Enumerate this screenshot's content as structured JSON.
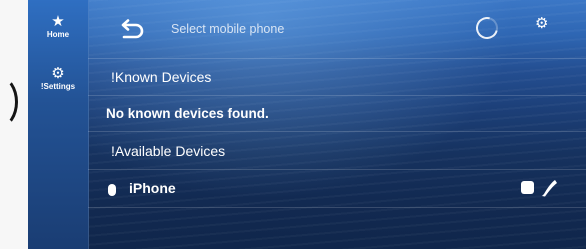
{
  "sidebar": {
    "items": [
      {
        "label": "Home",
        "icon": "star-icon",
        "glyph": "★"
      },
      {
        "label": "!Settings",
        "icon": "settings-icon",
        "glyph": "⚙"
      }
    ]
  },
  "header": {
    "title": "Select mobile phone",
    "settings_glyph": "⚙"
  },
  "list": {
    "known_header": "!Known Devices",
    "no_devices": "No known devices found.",
    "available_header": "!Available Devices",
    "devices": [
      {
        "name": "iPhone"
      }
    ]
  },
  "colors": {
    "accent": "#2f6fc2",
    "text": "#ffffff",
    "background": "#16325f"
  }
}
